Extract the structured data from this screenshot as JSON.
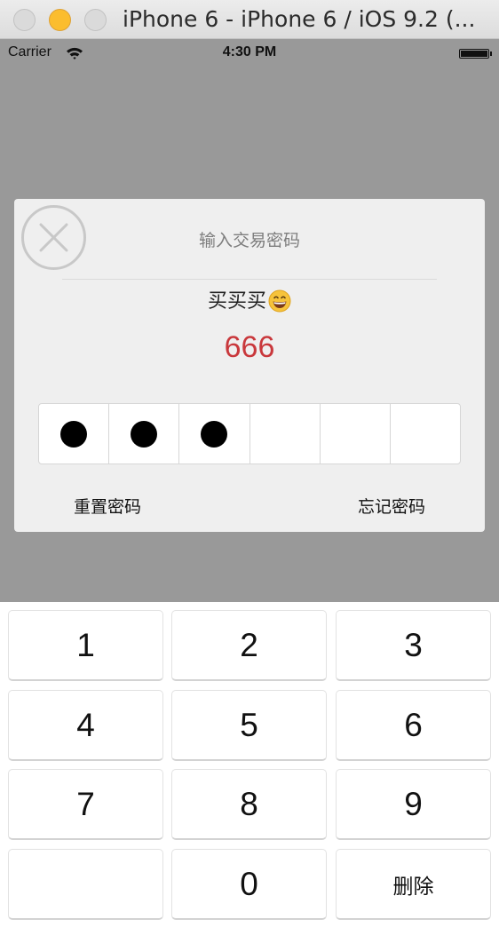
{
  "window": {
    "title": "iPhone 6 - iPhone 6 / iOS 9.2 (..."
  },
  "status_bar": {
    "carrier": "Carrier",
    "time": "4:30 PM"
  },
  "dialog": {
    "title": "输入交易密码",
    "subtitle": "买买买",
    "subtitle_emoji": "grinning-face-emoji",
    "amount": "666",
    "password": {
      "length": 6,
      "filled": 3
    },
    "reset_label": "重置密码",
    "forgot_label": "忘记密码"
  },
  "keypad": {
    "keys": [
      "1",
      "2",
      "3",
      "4",
      "5",
      "6",
      "7",
      "8",
      "9",
      "",
      "0",
      "删除"
    ]
  },
  "colors": {
    "dim_overlay": "#999999",
    "dialog_bg": "#efefef",
    "amount": "#c9383c",
    "title_text": "#7d7d7d"
  }
}
